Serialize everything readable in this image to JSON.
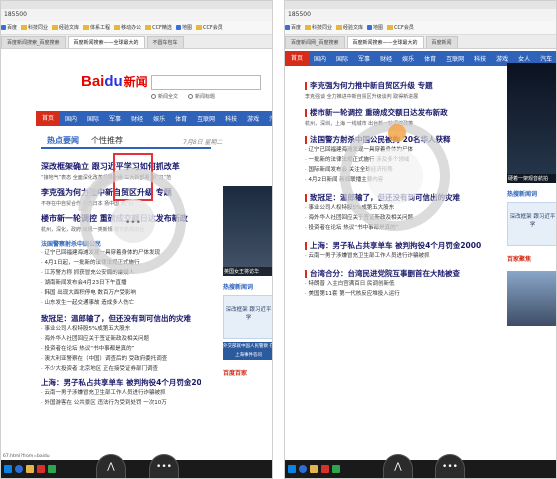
{
  "left": {
    "address": "185500",
    "bookmarks": [
      "百度",
      "科技同业",
      "经验文库",
      "体系工程",
      "移动办公",
      "CCF精选",
      "地图",
      "CCF会员"
    ],
    "tabs": [
      "百度新闻搜索_百度搜索",
      "百度新闻搜索——全球最大的",
      "不圆车包车"
    ],
    "logo": {
      "p1": "Bai",
      "p2": "du",
      "p3": "新闻"
    },
    "radio_options": [
      "新闻全文",
      "新闻标题"
    ],
    "nav": [
      "首页",
      "国内",
      "国际",
      "军事",
      "财经",
      "娱乐",
      "体育",
      "互联网",
      "科技",
      "游戏",
      "汽车",
      "房产"
    ],
    "subtabs": [
      "热点要闻",
      "个性推荐"
    ],
    "weekday": "7月8日 星期二",
    "news": [
      {
        "title": "深改框架确立 跟习近平学习如何抓改革",
        "big": true
      },
      {
        "sub": "“接地气”表态 全面深化改革领导小组 三大新部署 新”习“范"
      },
      {
        "title": "李克强为何力推中新自贸区升级 专题",
        "big": true
      },
      {
        "sub": "不存在中自贸合作 中方日本 扬中国 大”行 "
      },
      {
        "title": "楼市新一轮调控 重磅成交额日达发布新政",
        "big": true
      },
      {
        "sub": "杭州，深化，政府 出现一类新规 楼市新规出台"
      }
    ],
    "section": "法国警察射杀中国公民",
    "bullets": [
      "辽宁已回福建海滩发现一具穿着身体的尸体发现",
      "4月1日起，一批新的法律法规正式施行",
      "江苏警方称 抓获冒充公安局的嫌疑人",
      "湖南新闻发布会4月23日下午直播",
      "韩国 出现大面积停电 数百万户受影响",
      "山东发生一起交通事故 造成多人伤亡"
    ],
    "news2": [
      {
        "title": "致冠足：温郎输了，但还没有到可信出的灾难"
      },
      {
        "sub": "事业公司人权特股5%成第五大股东"
      },
      {
        "sub": "海外华人社团回应关于签证新政及相关问题"
      },
      {
        "sub": "投资者在论坛 热议“书中事都是真的”"
      },
      {
        "sub": "澳大利亚警察在（中国）调查后的 受政府委托调查"
      },
      {
        "sub": "不少大投资者 北京地区 正在接受证券部门调查"
      },
      {
        "title": "上海：男子私占共享单车 被判拘役4个月罚金2000"
      },
      {
        "sub": "云南一男子涉嫌冒充卫生部工作人员进行诈骗被抓"
      },
      {
        "sub": "外国游客在 公共景区 违法行为受到处罚 一次10万"
      }
    ],
    "side": {
      "photo_caption": "英国女王将访华",
      "label": "热搜新闻词",
      "ad_text": "深改框架 跟习近平学",
      "ad_strip": "外交部就中国人民警察 在上海事件答问",
      "foot": "百度百家"
    },
    "status": "67.html?from=baidu",
    "taskbar_button": "⋀"
  },
  "right": {
    "address": "185500",
    "bookmarks": [
      "百度",
      "科技同业",
      "经验文库",
      "地图",
      "CCF会员"
    ],
    "tabs": [
      "百度新闻网_百度搜索",
      "百度新闻搜索——全球最大的",
      "百度新闻"
    ],
    "nav": [
      "首页",
      "国内",
      "国际",
      "军事",
      "财经",
      "娱乐",
      "体育",
      "互联网",
      "科技",
      "游戏",
      "女人",
      "汽车",
      "房产"
    ],
    "news": [
      {
        "title": "李克强为何力推中新自贸区升级 专题"
      },
      {
        "sub": "李克强谈 全力推进中新自贸区升级谈判 取得新进展"
      },
      {
        "title": "楼市新一轮调控 重磅成交额日达发布新政"
      },
      {
        "sub": "杭州，深圳，上海 一线城市 出台新一轮调控政策"
      },
      {
        "title": "法国警方射杀中国公民被拘 20名华人获释"
      },
      {
        "sub": "辽宁已回福建海滩发现一具穿着身体的尸体"
      },
      {
        "sub": "一批新的法律法规正式施行 涉及多个领域"
      },
      {
        "sub": "国际新闻发布会 关注全球经济形势"
      },
      {
        "sub": "4月2日新闻 新闻联播主要内容"
      }
    ],
    "news2": [
      {
        "title": "致冠足：温郎输了，但还没有到可信出的灾难"
      },
      {
        "sub": "事业公司人权特股5%成第五大股东"
      },
      {
        "sub": "海外华人社团回应关于签证新政及相关问题"
      },
      {
        "sub": "投资者在论坛 热议“书中事都是真的”"
      },
      {
        "title": "上海：男子私占共享单车 被判拘役4个月罚金2000"
      },
      {
        "sub": "云南一男子涉嫌冒充卫生部工作人员进行诈骗被抓"
      },
      {
        "title": "台湾合分：台湾民进党院互事删首在大陆被查"
      },
      {
        "sub": "特朗普 入主白宫满百日 民调创新低"
      },
      {
        "sub": "美国第11套 第一代核反应堆投入运行"
      }
    ],
    "side": {
      "photo_caption": "硬着一架观音航拍",
      "label": "热搜新闻词",
      "ad_text": "深改框架 跟习近平学",
      "foot": "百家聚焦"
    },
    "taskbar_button": "⋀"
  }
}
